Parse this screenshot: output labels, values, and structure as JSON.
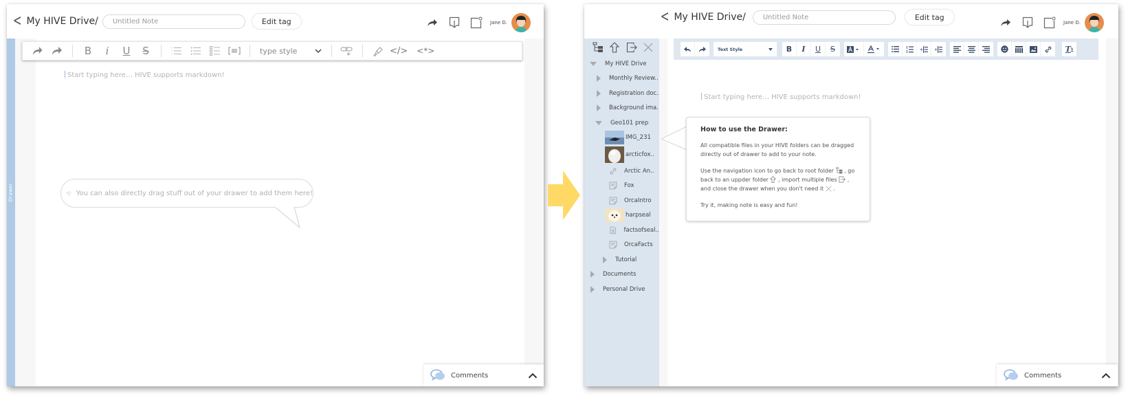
{
  "left_window": {
    "header": {
      "back_label": "<",
      "breadcrumb": "My HIVE Drive/",
      "title_placeholder": "Untitled Note",
      "edit_tag_label": "Edit tag",
      "user_name": "Jane D.",
      "icons": [
        "share-icon",
        "download-icon",
        "new-note-icon"
      ]
    },
    "drawer_tab_label": "Drawer",
    "toolbar": {
      "undo": "↶",
      "redo": "↷",
      "bold": "B",
      "italic": "i",
      "underline": "U",
      "strike": "S",
      "type_style": "type style",
      "code": "</>",
      "regex": "<*>"
    },
    "editor_placeholder": "Start typing here… HIVE supports markdown!",
    "hint_bubble": "You can also directly drag stuff out of your drawer to add them here!",
    "comments": {
      "label": "Comments",
      "chevron": "^"
    }
  },
  "transition_arrow_color": "#ffd966",
  "right_window": {
    "header": {
      "back_label": "<",
      "breadcrumb": "My HIVE Drive/",
      "title_placeholder": "Untitled Note",
      "edit_tag_label": "Edit tag",
      "user_name": "Jane D."
    },
    "drawer": {
      "tools": [
        "root-folder-icon",
        "up-folder-icon",
        "import-icon",
        "close-icon"
      ],
      "tree": [
        {
          "label": "My HIVE Drive",
          "type": "folder",
          "expanded": true,
          "level": 0
        },
        {
          "label": "Monthly Review..",
          "type": "folder",
          "expanded": false,
          "level": 1
        },
        {
          "label": "Registration doc..",
          "type": "folder",
          "expanded": false,
          "level": 1
        },
        {
          "label": "Background ima..",
          "type": "folder",
          "expanded": false,
          "level": 1
        },
        {
          "label": "Geo101 prep",
          "type": "folder",
          "expanded": true,
          "level": 1
        },
        {
          "label": "IMG_231",
          "type": "image",
          "level": 2
        },
        {
          "label": "arcticfox..",
          "type": "image",
          "level": 2
        },
        {
          "label": "Arctic An..",
          "type": "link",
          "level": 2
        },
        {
          "label": "Fox",
          "type": "note",
          "level": 2
        },
        {
          "label": "OrcaIntro",
          "type": "note",
          "level": 2
        },
        {
          "label": "harpseal",
          "type": "image",
          "level": 2
        },
        {
          "label": "factsofseal..",
          "type": "document",
          "level": 2
        },
        {
          "label": "OrcaFacts",
          "type": "note",
          "level": 2
        },
        {
          "label": "Tutorial",
          "type": "folder",
          "expanded": false,
          "level": 2
        },
        {
          "label": "Documents",
          "type": "folder",
          "expanded": false,
          "level": 0
        },
        {
          "label": "Personal Drive",
          "type": "folder",
          "expanded": false,
          "level": 0
        }
      ]
    },
    "toolbar": {
      "text_style": "Text Style",
      "bold": "B",
      "italic": "I",
      "underline": "U",
      "strike": "S",
      "clear_format": "Tx"
    },
    "editor_placeholder": "Start typing here… HIVE supports markdown!",
    "help": {
      "title": "How to use the Drawer:",
      "p1": "All compatible files in your HIVE folders can be dragged directly out of drawer to add to your note.",
      "p2a": "Use the navigation icon to go back to root folder",
      "p2b": ", go back to an uppder folder",
      "p2c": ", import multiple files",
      "p2d": ", and close the drawer when you don't need it",
      "p2e": ".",
      "p3": "Try it, making note is easy and fun!"
    },
    "comments": {
      "label": "Comments",
      "chevron": "^"
    }
  }
}
